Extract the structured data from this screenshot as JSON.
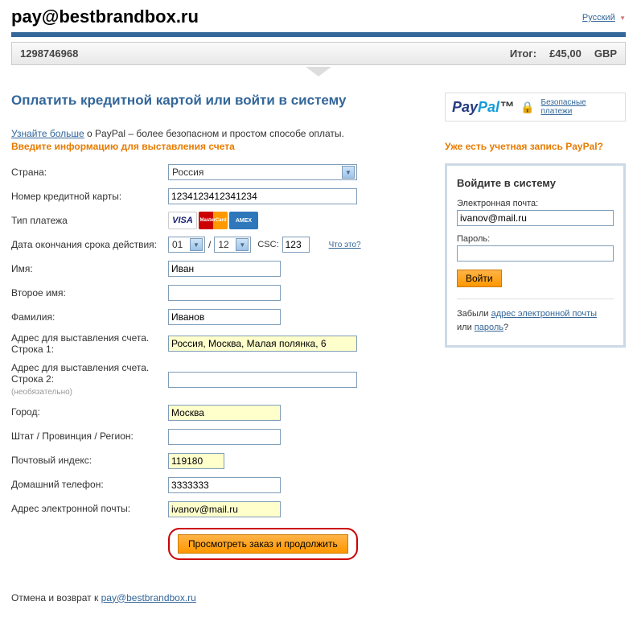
{
  "header": {
    "title": "pay@bestbrandbox.ru",
    "lang": "Русский"
  },
  "order": {
    "id": "1298746968",
    "total_label": "Итог:",
    "amount": "£45,00",
    "currency": "GBP"
  },
  "main": {
    "heading": "Оплатить кредитной картой или войти в систему",
    "learn_more": "Узнайте больше",
    "learn_more_rest": " о PayPal – более безопасном и простом способе оплаты.",
    "billing_prompt": "Введите информацию для выставления счета",
    "labels": {
      "country": "Страна:",
      "card_number": "Номер кредитной карты:",
      "payment_type": "Тип платежа",
      "expiry": "Дата окончания срока действия:",
      "csc": "CSC:",
      "what": "Что это?",
      "first_name": "Имя:",
      "middle_name": "Второе имя:",
      "last_name": "Фамилия:",
      "address1": "Адрес для выставления счета. Строка 1:",
      "address2": "Адрес для выставления счета. Строка 2:",
      "optional": "(необязательно)",
      "city": "Город:",
      "state": "Штат / Провинция / Регион:",
      "postal": "Почтовый индекс:",
      "phone": "Домашний телефон:",
      "email": "Адрес электронной почты:"
    },
    "values": {
      "country": "Россия",
      "card_number": "1234123412341234",
      "exp_month": "01",
      "exp_year": "12",
      "csc": "123",
      "first_name": "Иван",
      "middle_name": "",
      "last_name": "Иванов",
      "address1": "Россия, Москва, Малая полянка, 6",
      "address2": "",
      "city": "Москва",
      "state": "",
      "postal": "119180",
      "phone": "3333333",
      "email": "ivanov@mail.ru"
    },
    "submit": "Просмотреть заказ и продолжить"
  },
  "paypal_box": {
    "safe": "Безопасные платежи"
  },
  "sidebar": {
    "heading": "Уже есть учетная запись PayPal?",
    "login_title": "Войдите в систему",
    "email_label": "Электронная почта:",
    "email_value": "ivanov@mail.ru",
    "password_label": "Пароль:",
    "login_btn": "Войти",
    "forgot_prefix": "Забыли ",
    "forgot_email": "адрес электронной почты",
    "forgot_or": " или ",
    "forgot_password": "пароль",
    "forgot_suffix": "?"
  },
  "footer": {
    "prefix": "Отмена и возврат к ",
    "link": "pay@bestbrandbox.ru"
  }
}
